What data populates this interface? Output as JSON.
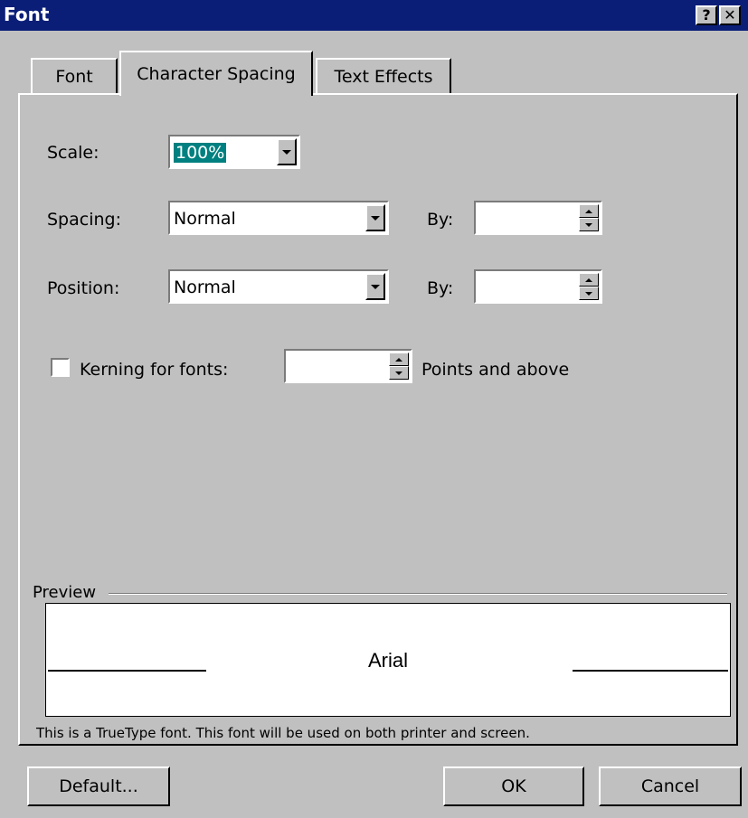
{
  "window": {
    "title": "Font",
    "help_glyph": "?",
    "close_glyph": "✕"
  },
  "tabs": [
    {
      "label": "Font",
      "active": false
    },
    {
      "label": "Character Spacing",
      "active": true
    },
    {
      "label": "Text Effects",
      "active": false
    }
  ],
  "scale": {
    "label": "Scale:",
    "value": "100%"
  },
  "spacing": {
    "label": "Spacing:",
    "value": "Normal",
    "by_label": "By:",
    "by_value": ""
  },
  "position": {
    "label": "Position:",
    "value": "Normal",
    "by_label": "By:",
    "by_value": ""
  },
  "kerning": {
    "label": "Kerning for fonts:",
    "checked": false,
    "value": "",
    "suffix": "Points and above"
  },
  "preview": {
    "label": "Preview",
    "sample": "Arial"
  },
  "info_text": "This is a TrueType font. This font will be used on both printer and screen.",
  "buttons": {
    "default": "Default...",
    "ok": "OK",
    "cancel": "Cancel"
  },
  "colors": {
    "titlebar": "#0a1e78",
    "face": "#c0c0c0",
    "selection": "#008080"
  }
}
